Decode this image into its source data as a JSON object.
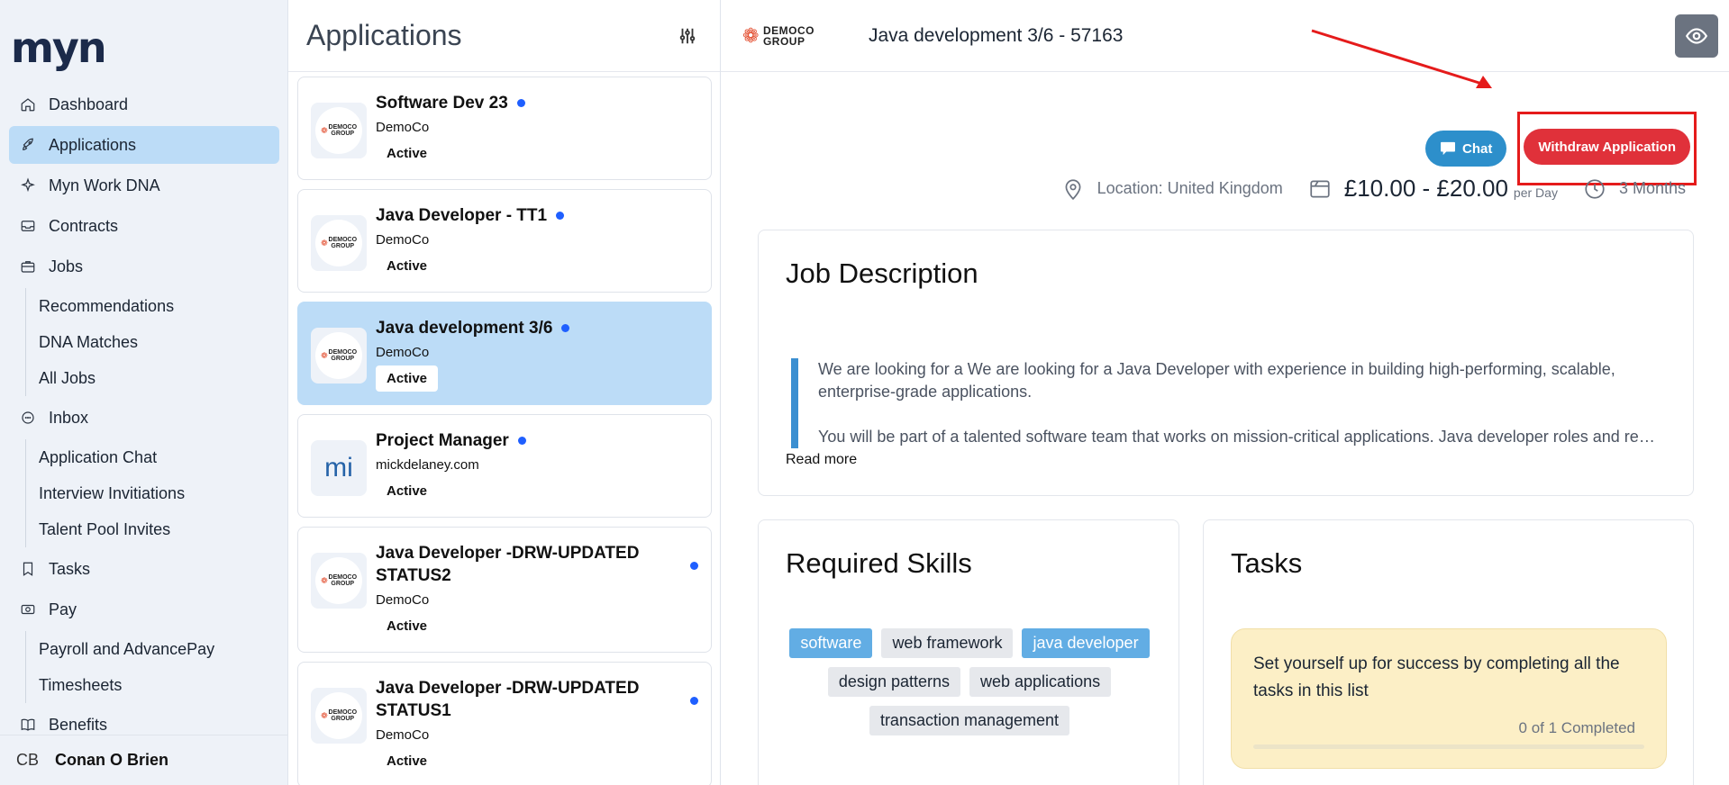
{
  "sidebar": {
    "logo": "myn",
    "items": [
      {
        "label": "Dashboard",
        "icon": "home-icon"
      },
      {
        "label": "Applications",
        "icon": "rocket-icon",
        "active": true
      },
      {
        "label": "Myn Work DNA",
        "icon": "sparkle-icon"
      },
      {
        "label": "Contracts",
        "icon": "inbox-tray-icon"
      },
      {
        "label": "Jobs",
        "icon": "briefcase-icon",
        "children": [
          "Recommendations",
          "DNA Matches",
          "All Jobs"
        ]
      },
      {
        "label": "Inbox",
        "icon": "chat-bubble-icon",
        "children": [
          "Application Chat",
          "Interview Invitiations",
          "Talent Pool Invites"
        ]
      },
      {
        "label": "Tasks",
        "icon": "bookmark-icon"
      },
      {
        "label": "Pay",
        "icon": "money-icon",
        "children": [
          "Payroll and AdvancePay",
          "Timesheets"
        ]
      },
      {
        "label": "Benefits",
        "icon": "book-icon"
      }
    ],
    "user": {
      "initials": "CB",
      "name": "Conan O Brien"
    }
  },
  "applications": {
    "title": "Applications",
    "items": [
      {
        "title": "Software Dev 23",
        "company": "DemoCo",
        "status": "Active",
        "logo": "democo"
      },
      {
        "title": "Java Developer - TT1",
        "company": "DemoCo",
        "status": "Active",
        "logo": "democo"
      },
      {
        "title": "Java development 3/6",
        "company": "DemoCo",
        "status": "Active",
        "logo": "democo",
        "selected": true
      },
      {
        "title": "Project Manager",
        "company": "mickdelaney.com",
        "status": "Active",
        "logo": "mi"
      },
      {
        "title": "Java Developer -DRW-UPDATED STATUS2",
        "company": "DemoCo",
        "status": "Active",
        "logo": "democo"
      },
      {
        "title": "Java Developer -DRW-UPDATED STATUS1",
        "company": "DemoCo",
        "status": "Active",
        "logo": "democo"
      }
    ],
    "logo_text": {
      "mark": "❁",
      "line1": "DEMOCO",
      "line2": "GROUP",
      "mi": "mi"
    }
  },
  "detail": {
    "company_logo": {
      "line1": "DEMOCO",
      "line2": "GROUP"
    },
    "heading": "Java development 3/6 - 57163",
    "chat_label": "Chat",
    "withdraw_label": "Withdraw Application",
    "location": "Location: United Kingdom",
    "salary": "£10.00 - £20.00",
    "salary_period": "per Day",
    "duration": "3 Months",
    "job_description": {
      "title": "Job Description",
      "paragraph1": "We are looking for a We are looking for a Java Developer with experience in building high-performing, scalable, enterprise-grade applications.",
      "paragraph2": "You will be part of a talented software team that works on mission-critical applications. Java developer roles and responsibilities include managing Java/Java EE application development.",
      "read_more": "Read more"
    },
    "required_skills": {
      "title": "Required Skills",
      "skills": [
        {
          "label": "software",
          "highlighted": true
        },
        {
          "label": "web framework",
          "highlighted": false
        },
        {
          "label": "java developer",
          "highlighted": true
        },
        {
          "label": "design patterns",
          "highlighted": false
        },
        {
          "label": "web applications",
          "highlighted": false
        },
        {
          "label": "transaction management",
          "highlighted": false
        }
      ]
    },
    "tasks": {
      "title": "Tasks",
      "message": "Set yourself up for success by completing all the tasks in this list",
      "progress_text": "0 of 1 Completed",
      "completed": 0,
      "total": 1
    }
  },
  "colors": {
    "accent": "#bcdcf7",
    "chat": "#2d8fcb",
    "withdraw": "#e0313a",
    "highlight_box": "#e51b1b"
  }
}
